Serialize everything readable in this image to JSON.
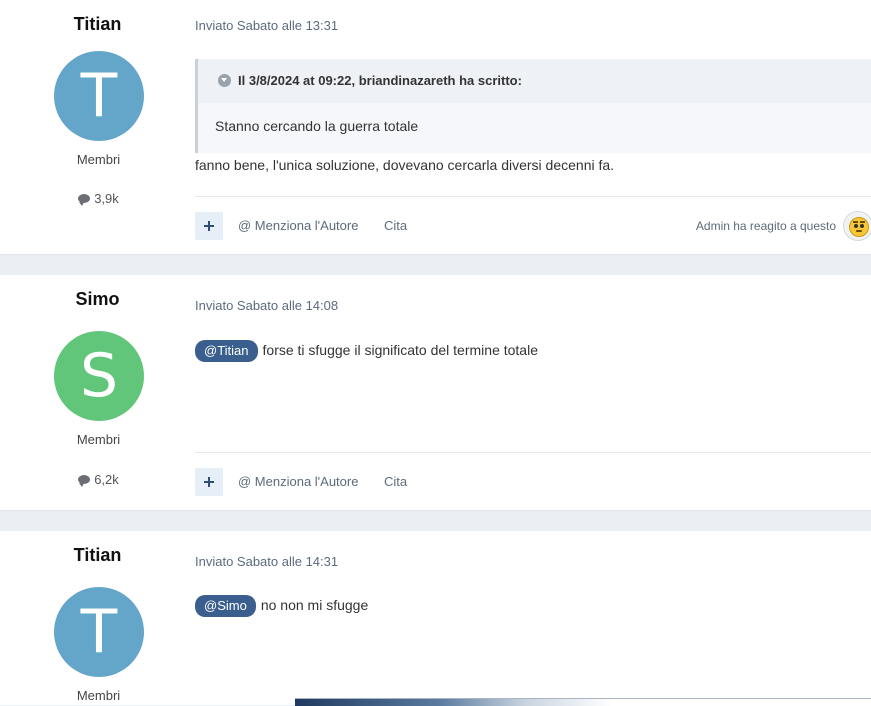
{
  "posts": [
    {
      "author": "Titian",
      "avatar_letter": "T",
      "avatar_color": "#63a6ca",
      "role": "Membri",
      "post_count": "3,9k",
      "meta": "Inviato Sabato alle 13:31",
      "quote": {
        "header": "Il 3/8/2024 at 09:22, briandinazareth ha scritto:",
        "body": "Stanno cercando la guerra totale"
      },
      "text": "fanno bene, l'unica soluzione, dovevano cercarla diversi decenni fa.",
      "actions": {
        "mention": "@ Menziona l'Autore",
        "cite": "Cita"
      },
      "reaction": "Admin ha reagito a questo"
    },
    {
      "author": "Simo",
      "avatar_letter": "S",
      "avatar_color": "#62c67a",
      "role": "Membri",
      "post_count": "6,2k",
      "meta": "Inviato Sabato alle 14:08",
      "mention": "@Titian",
      "text": "forse ti sfugge il significato del termine totale",
      "actions": {
        "mention": "@ Menziona l'Autore",
        "cite": "Cita"
      }
    },
    {
      "author": "Titian",
      "avatar_letter": "T",
      "avatar_color": "#63a6ca",
      "role": "Membri",
      "meta": "Inviato Sabato alle 14:31",
      "mention": "@Simo",
      "text": "no non mi sfugge"
    }
  ],
  "colors": {
    "page_bg": "#ebeef2",
    "mention_badge": "#3a5f8e",
    "meta_text": "#5b6b80"
  },
  "icons": {
    "post_count": "comment-bubble-icon",
    "quote_toggle": "chevron-down-circle-icon",
    "react": "plus-icon",
    "reaction": "confused-face-emoji-icon"
  }
}
